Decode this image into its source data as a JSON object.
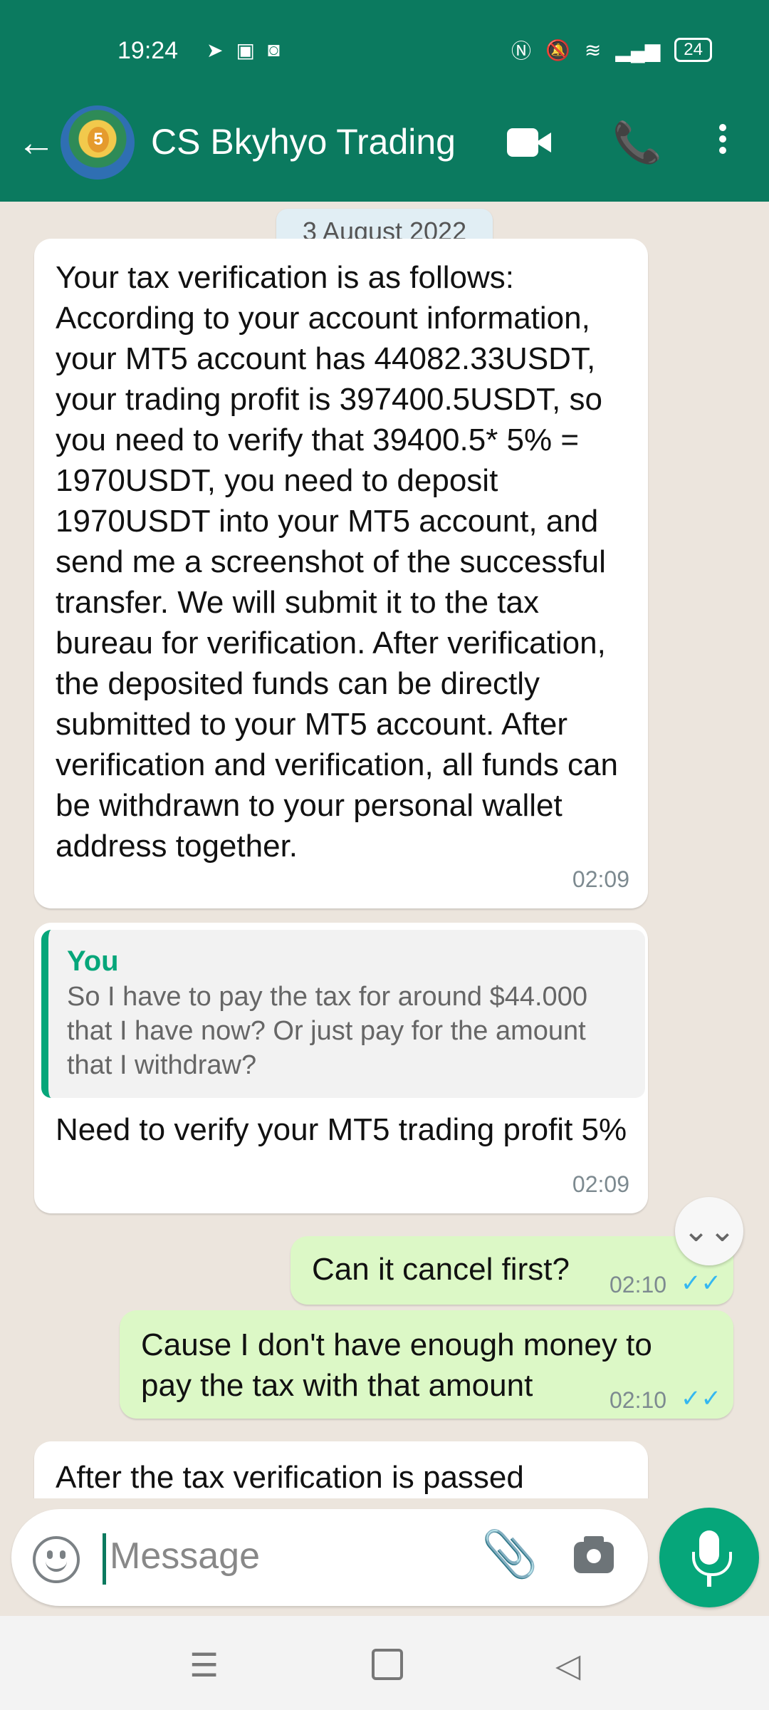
{
  "status": {
    "time": "19:24",
    "battery": "24",
    "icons": [
      "telegram-icon",
      "app-icon",
      "robot-icon",
      "nfc-icon",
      "mute-icon",
      "wifi-icon",
      "signal-icon"
    ]
  },
  "header": {
    "title": "CS Bkyhyo Trading",
    "avatar_badge": "5",
    "back_icon": "←",
    "phone_icon": "📞"
  },
  "date_chip": "3 August 2022",
  "messages": [
    {
      "text": "Your tax verification is as follows: According to your account information, your MT5 account has 44082.33USDT, your trading profit is 397400.5USDT, so you need to verify that 39400.5* 5% = 1970USDT, you need to deposit 1970USDT into your MT5 account, and send me a screenshot of the successful transfer. We will submit it to the tax bureau for verification. After verification, the deposited funds can be directly submitted to your MT5 account. After verification and verification, all funds can be withdrawn to your personal wallet address together.",
      "time": "02:09"
    },
    {
      "quote_author": "You",
      "quote_text": "So I have to pay the tax for around $44.000 that I have now? Or just pay for the amount that I withdraw?",
      "text": "Need to verify your MT5 trading profit 5%",
      "time": "02:09"
    },
    {
      "text": "Can it cancel first?",
      "time": "02:10",
      "ticks": "✓✓"
    },
    {
      "text": "Cause I don't have enough money to pay the tax with that amount",
      "time": "02:10",
      "ticks": "✓✓"
    },
    {
      "text": "After the tax verification is passed"
    }
  ],
  "input": {
    "placeholder": "Message",
    "clip_icon": "📎"
  },
  "scroll_icon": "⌄⌄",
  "nav": {
    "menu": "☰",
    "back": "◁"
  }
}
